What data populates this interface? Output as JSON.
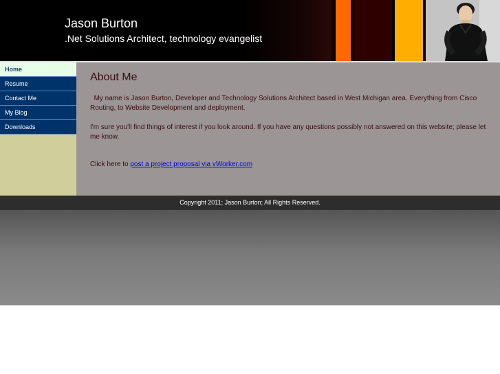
{
  "header": {
    "title": "Jason Burton",
    "subtitle": ".Net Solutions Architect, technology evangelist",
    "colors": {
      "stripe_orange": "#ff6a00",
      "stripe_maroon": "#2e0000",
      "stripe_amber": "#ffae00"
    },
    "photo_icon": "person-photo"
  },
  "nav": {
    "items": [
      {
        "label": "Home",
        "active": true
      },
      {
        "label": "Resume",
        "active": false
      },
      {
        "label": "Contact Me",
        "active": false
      },
      {
        "label": "My Blog",
        "active": false
      },
      {
        "label": "Downloads",
        "active": false
      }
    ]
  },
  "main": {
    "heading": "About Me",
    "paragraph1": "My name is Jason Burton, Developer and Technology Solutions Architect based in West Michigan area. Everything from Cisco Routing, to Website Development and deployment.",
    "paragraph2": "I'm sure you'll find things of interest if you look around. If you have any questions possibly not answered on this website; please let me know.",
    "cta_prefix": "Click here to ",
    "cta_link": "post a project proposal via vWorker.com"
  },
  "footer": {
    "copyright": "Copyright 2011; Jason Burton; All Rights Reserved."
  }
}
